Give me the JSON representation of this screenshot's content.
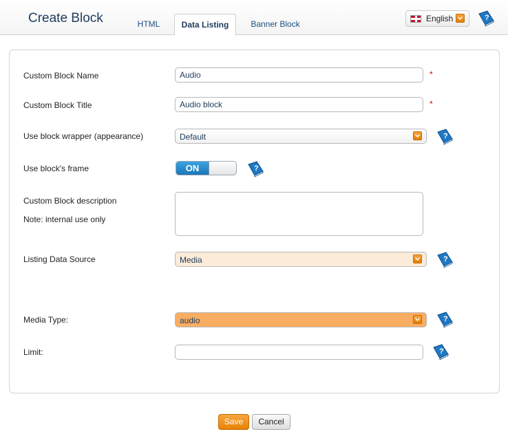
{
  "header": {
    "title": "Create Block",
    "tabs": [
      {
        "label": "HTML",
        "active": false
      },
      {
        "label": "Data Listing",
        "active": true
      },
      {
        "label": "Banner Block",
        "active": false
      }
    ],
    "language": {
      "label": "English",
      "flag": "uk-flag-icon"
    }
  },
  "form": {
    "name": {
      "label": "Custom Block Name",
      "value": "Audio",
      "required_mark": "*"
    },
    "title": {
      "label": "Custom Block Title",
      "value": "Audio block",
      "required_mark": "*"
    },
    "wrapper": {
      "label": "Use block wrapper (appearance)",
      "value": "Default"
    },
    "frame": {
      "label": "Use block's frame",
      "toggle_label": "ON",
      "state": "on"
    },
    "description": {
      "label": "Custom Block description",
      "note": "Note: internal use only",
      "value": ""
    },
    "source": {
      "label": "Listing Data Source",
      "value": "Media",
      "bg_color": "#fbebd9"
    },
    "media_type": {
      "label": "Media Type:",
      "value": "audio",
      "bg_color": "#f9ad62"
    },
    "limit": {
      "label": "Limit:",
      "value": ""
    }
  },
  "actions": {
    "save": "Save",
    "cancel": "Cancel"
  },
  "colors": {
    "accent": "#e88205",
    "title": "#1d3b5c",
    "link": "#1d4f80"
  }
}
